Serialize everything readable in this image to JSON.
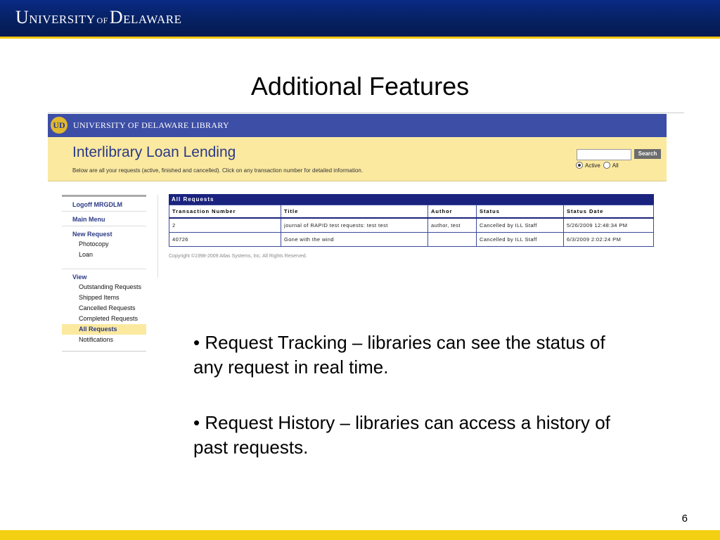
{
  "slide": {
    "logo": {
      "u": "U",
      "niversity": "NIVERSITY",
      "of": "OF",
      "d": "D",
      "elaware": "ELAWARE"
    },
    "title": "Additional Features",
    "page_number": "6",
    "bullets": [
      "• Request Tracking – libraries can see the status of any request in real time.",
      "• Request History – libraries can access a history of past requests."
    ]
  },
  "app": {
    "library_name": "UNIVERSITY OF DELAWARE LIBRARY",
    "seal_text": "UD",
    "title": "Interlibrary Loan Lending",
    "subtitle": "Below are all your requests (active, finished and cancelled). Click on any transaction number for detailed information.",
    "search": {
      "button_label": "Search",
      "value": ""
    },
    "scope_options": [
      {
        "label": "Active",
        "selected": true
      },
      {
        "label": "All",
        "selected": false
      }
    ],
    "nav": {
      "logoff": "Logoff MRGDLM",
      "main_menu": "Main Menu",
      "new_request": "New Request",
      "new_request_items": [
        "Photocopy",
        "Loan"
      ],
      "view": "View",
      "view_items": [
        "Outstanding Requests",
        "Shipped Items",
        "Cancelled Requests",
        "Completed Requests",
        "All Requests",
        "Notifications"
      ],
      "active_item": "All Requests"
    },
    "table": {
      "caption": "All Requests",
      "columns": [
        "Transaction Number",
        "Title",
        "Author",
        "Status",
        "Status Date"
      ],
      "rows": [
        [
          "2",
          "journal of RAPID test requests: test test",
          "author, test",
          "Cancelled by ILL Staff",
          "5/26/2009 12:48:34 PM"
        ],
        [
          "40726",
          "Gone with the wind",
          "",
          "Cancelled by ILL Staff",
          "6/3/2009 2:02:24 PM"
        ]
      ]
    },
    "copyright": "Copyright ©1998-2009 Atlas Systems, Inc. All Rights Reserved."
  },
  "colors": {
    "header_blue": "#06205f",
    "gold": "#f2c811",
    "app_blue": "#3d4ea6",
    "app_yellow": "#fbe9a0"
  }
}
